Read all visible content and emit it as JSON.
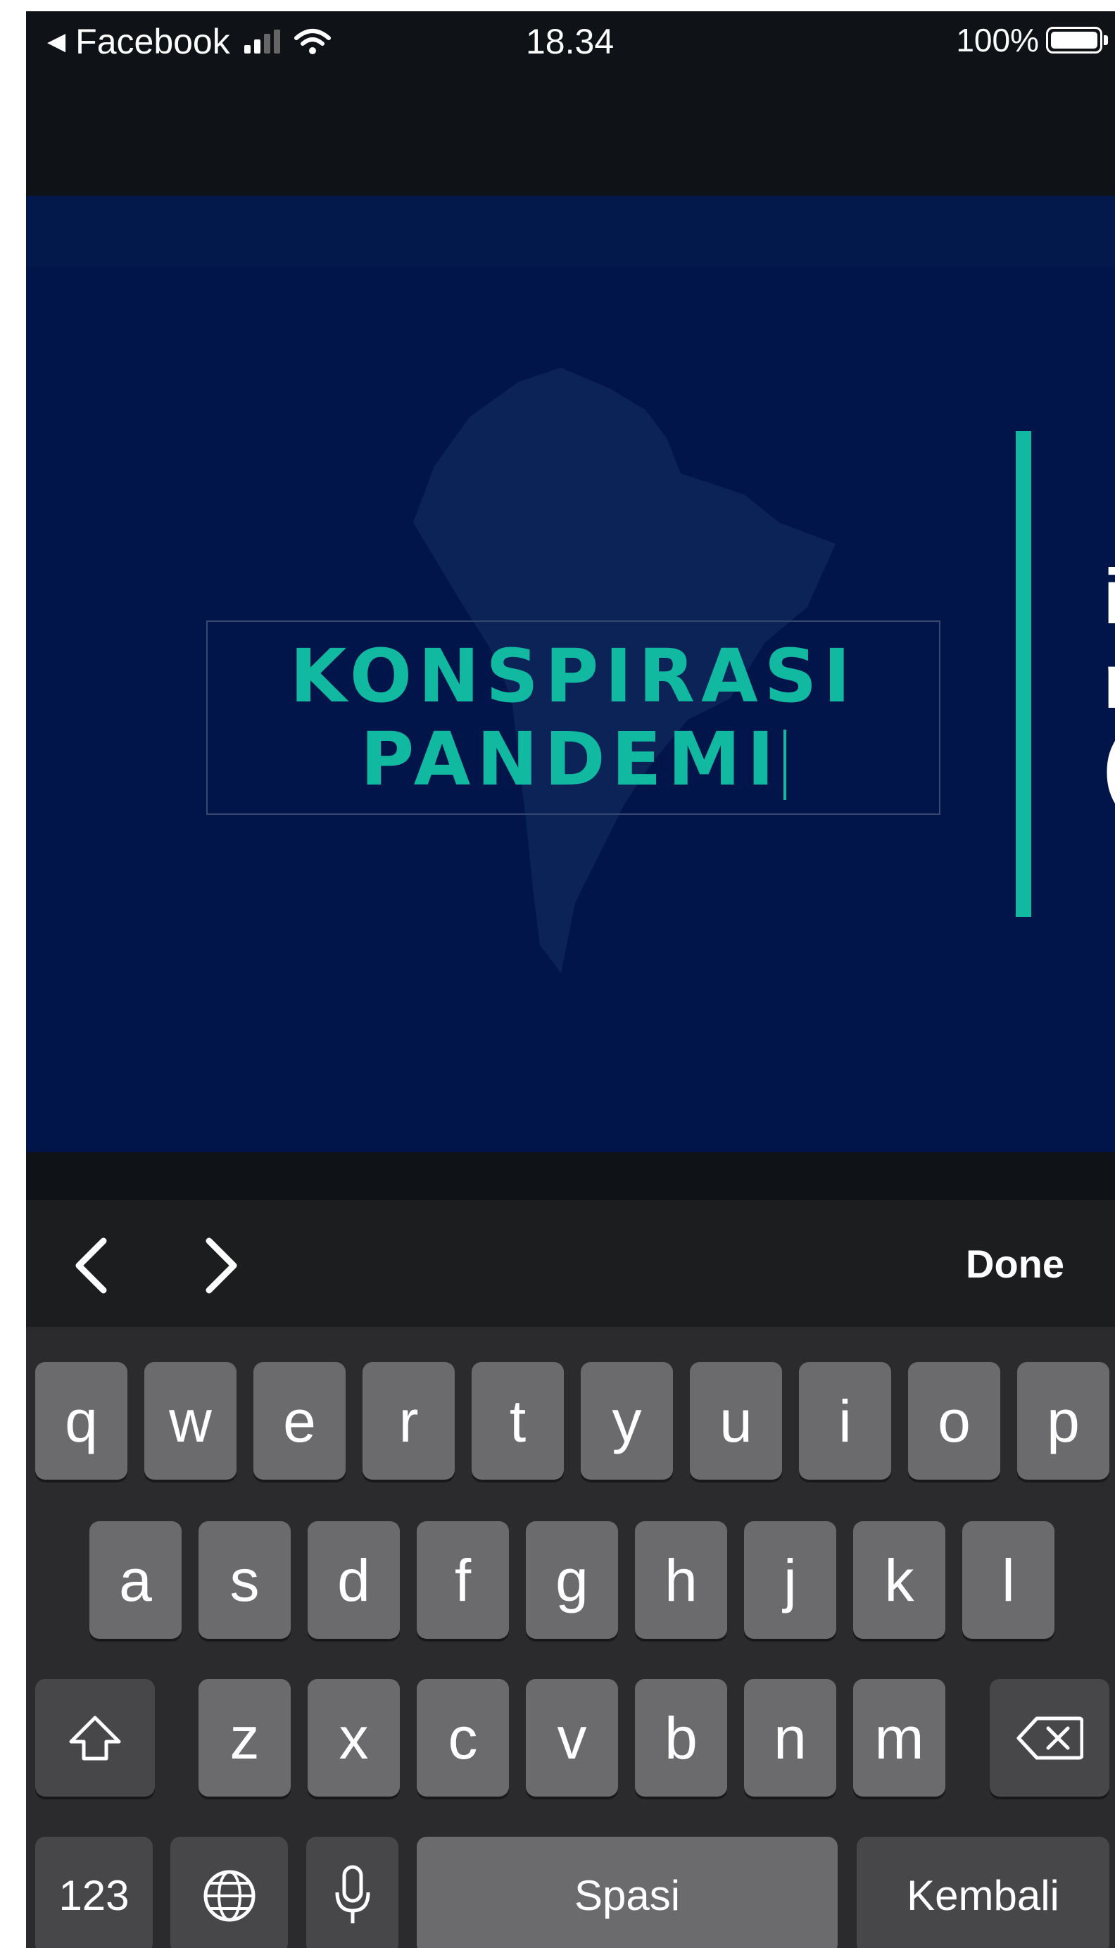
{
  "status_bar": {
    "back_app": "Facebook",
    "time": "18.34",
    "battery": "100%"
  },
  "slide": {
    "title_lines": [
      "KONSPIRASI",
      "PANDEMI"
    ],
    "partial_right_text": [
      "i",
      "r",
      "("
    ],
    "colors": {
      "background": "#02154a",
      "accent": "#10b9a0",
      "map": "#0b2356"
    }
  },
  "accessory": {
    "prev_icon": "chevron-left-icon",
    "next_icon": "chevron-right-icon",
    "done_label": "Done"
  },
  "keyboard": {
    "row1": [
      "q",
      "w",
      "e",
      "r",
      "t",
      "y",
      "u",
      "i",
      "o",
      "p"
    ],
    "row2": [
      "a",
      "s",
      "d",
      "f",
      "g",
      "h",
      "j",
      "k",
      "l"
    ],
    "row3": [
      "z",
      "x",
      "c",
      "v",
      "b",
      "n",
      "m"
    ],
    "shift_icon": "shift-icon",
    "backspace_icon": "backspace-icon",
    "numbers_label": "123",
    "globe_icon": "globe-icon",
    "mic_icon": "microphone-icon",
    "space_label": "Spasi",
    "return_label": "Kembali"
  }
}
